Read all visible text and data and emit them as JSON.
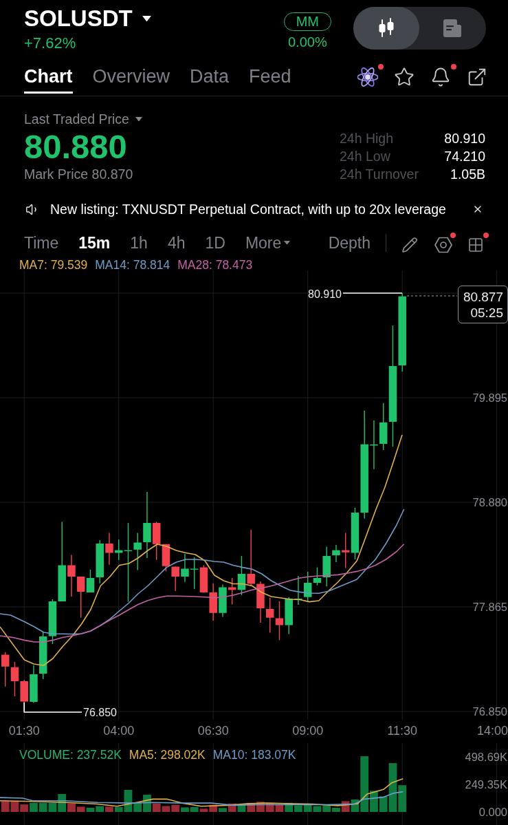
{
  "header": {
    "symbol": "SOLUSDT",
    "change": "+7.62%",
    "badge": "MM",
    "badge_change": "0.00%",
    "view_toggle": [
      {
        "kind": "chart",
        "selected": true
      },
      {
        "kind": "news",
        "selected": false
      }
    ]
  },
  "tabs": [
    {
      "label": "Chart",
      "selected": true
    },
    {
      "label": "Overview",
      "selected": false
    },
    {
      "label": "Data",
      "selected": false
    },
    {
      "label": "Feed",
      "selected": false
    }
  ],
  "tab_actions": [
    {
      "kind": "atom",
      "dot": true
    },
    {
      "kind": "star",
      "dot": false
    },
    {
      "kind": "bell",
      "dot": true
    },
    {
      "kind": "external_link",
      "dot": false
    }
  ],
  "price": {
    "label": "Last Traded Price",
    "value": "80.880",
    "mark_price": "Mark Price 80.870",
    "stats": [
      {
        "label": "24h High",
        "value": "80.910"
      },
      {
        "label": "24h Low",
        "value": "74.210"
      },
      {
        "label": "24h Turnover",
        "value": "1.05B"
      }
    ]
  },
  "announcement": {
    "text": "New listing: TXNUSDT Perpetual Contract, with up to 20x leverage"
  },
  "toolbar": {
    "intervals": [
      {
        "label": "Time",
        "selected": false
      },
      {
        "label": "15m",
        "selected": true
      },
      {
        "label": "1h",
        "selected": false
      },
      {
        "label": "4h",
        "selected": false
      },
      {
        "label": "1D",
        "selected": false
      }
    ],
    "more": "More",
    "depth": "Depth",
    "tools": [
      {
        "kind": "pencil",
        "dot": false
      },
      {
        "kind": "hexagon",
        "dot": true
      },
      {
        "kind": "grid",
        "dot": true
      }
    ]
  },
  "chart": {
    "indicators": [
      {
        "label": "MA7: 79.539",
        "color": "#e2b04a"
      },
      {
        "label": "MA14: 78.814",
        "color": "#6e9cc6"
      },
      {
        "label": "MA28: 78.473",
        "color": "#c460a6"
      }
    ],
    "price_axis": [
      "79.895",
      "78.880",
      "77.865",
      "76.850"
    ],
    "high_marker": "80.910",
    "low_marker": "76.850",
    "last_price": "80.877",
    "countdown": "05:25",
    "time_axis": [
      "01:30",
      "04:00",
      "06:30",
      "09:00",
      "11:30",
      "14:00"
    ]
  },
  "volume": {
    "indicators": [
      {
        "kind": "volume",
        "label": "VOLUME: 237.52K",
        "color": "#2bb36e"
      },
      {
        "kind": "ma",
        "label": "MA5: 298.02K",
        "color": "#e2b04a"
      },
      {
        "kind": "ma",
        "label": "MA10: 183.07K",
        "color": "#6e9cc6"
      }
    ],
    "axis": [
      "498.69K",
      "249.35K",
      "0.000"
    ]
  }
}
